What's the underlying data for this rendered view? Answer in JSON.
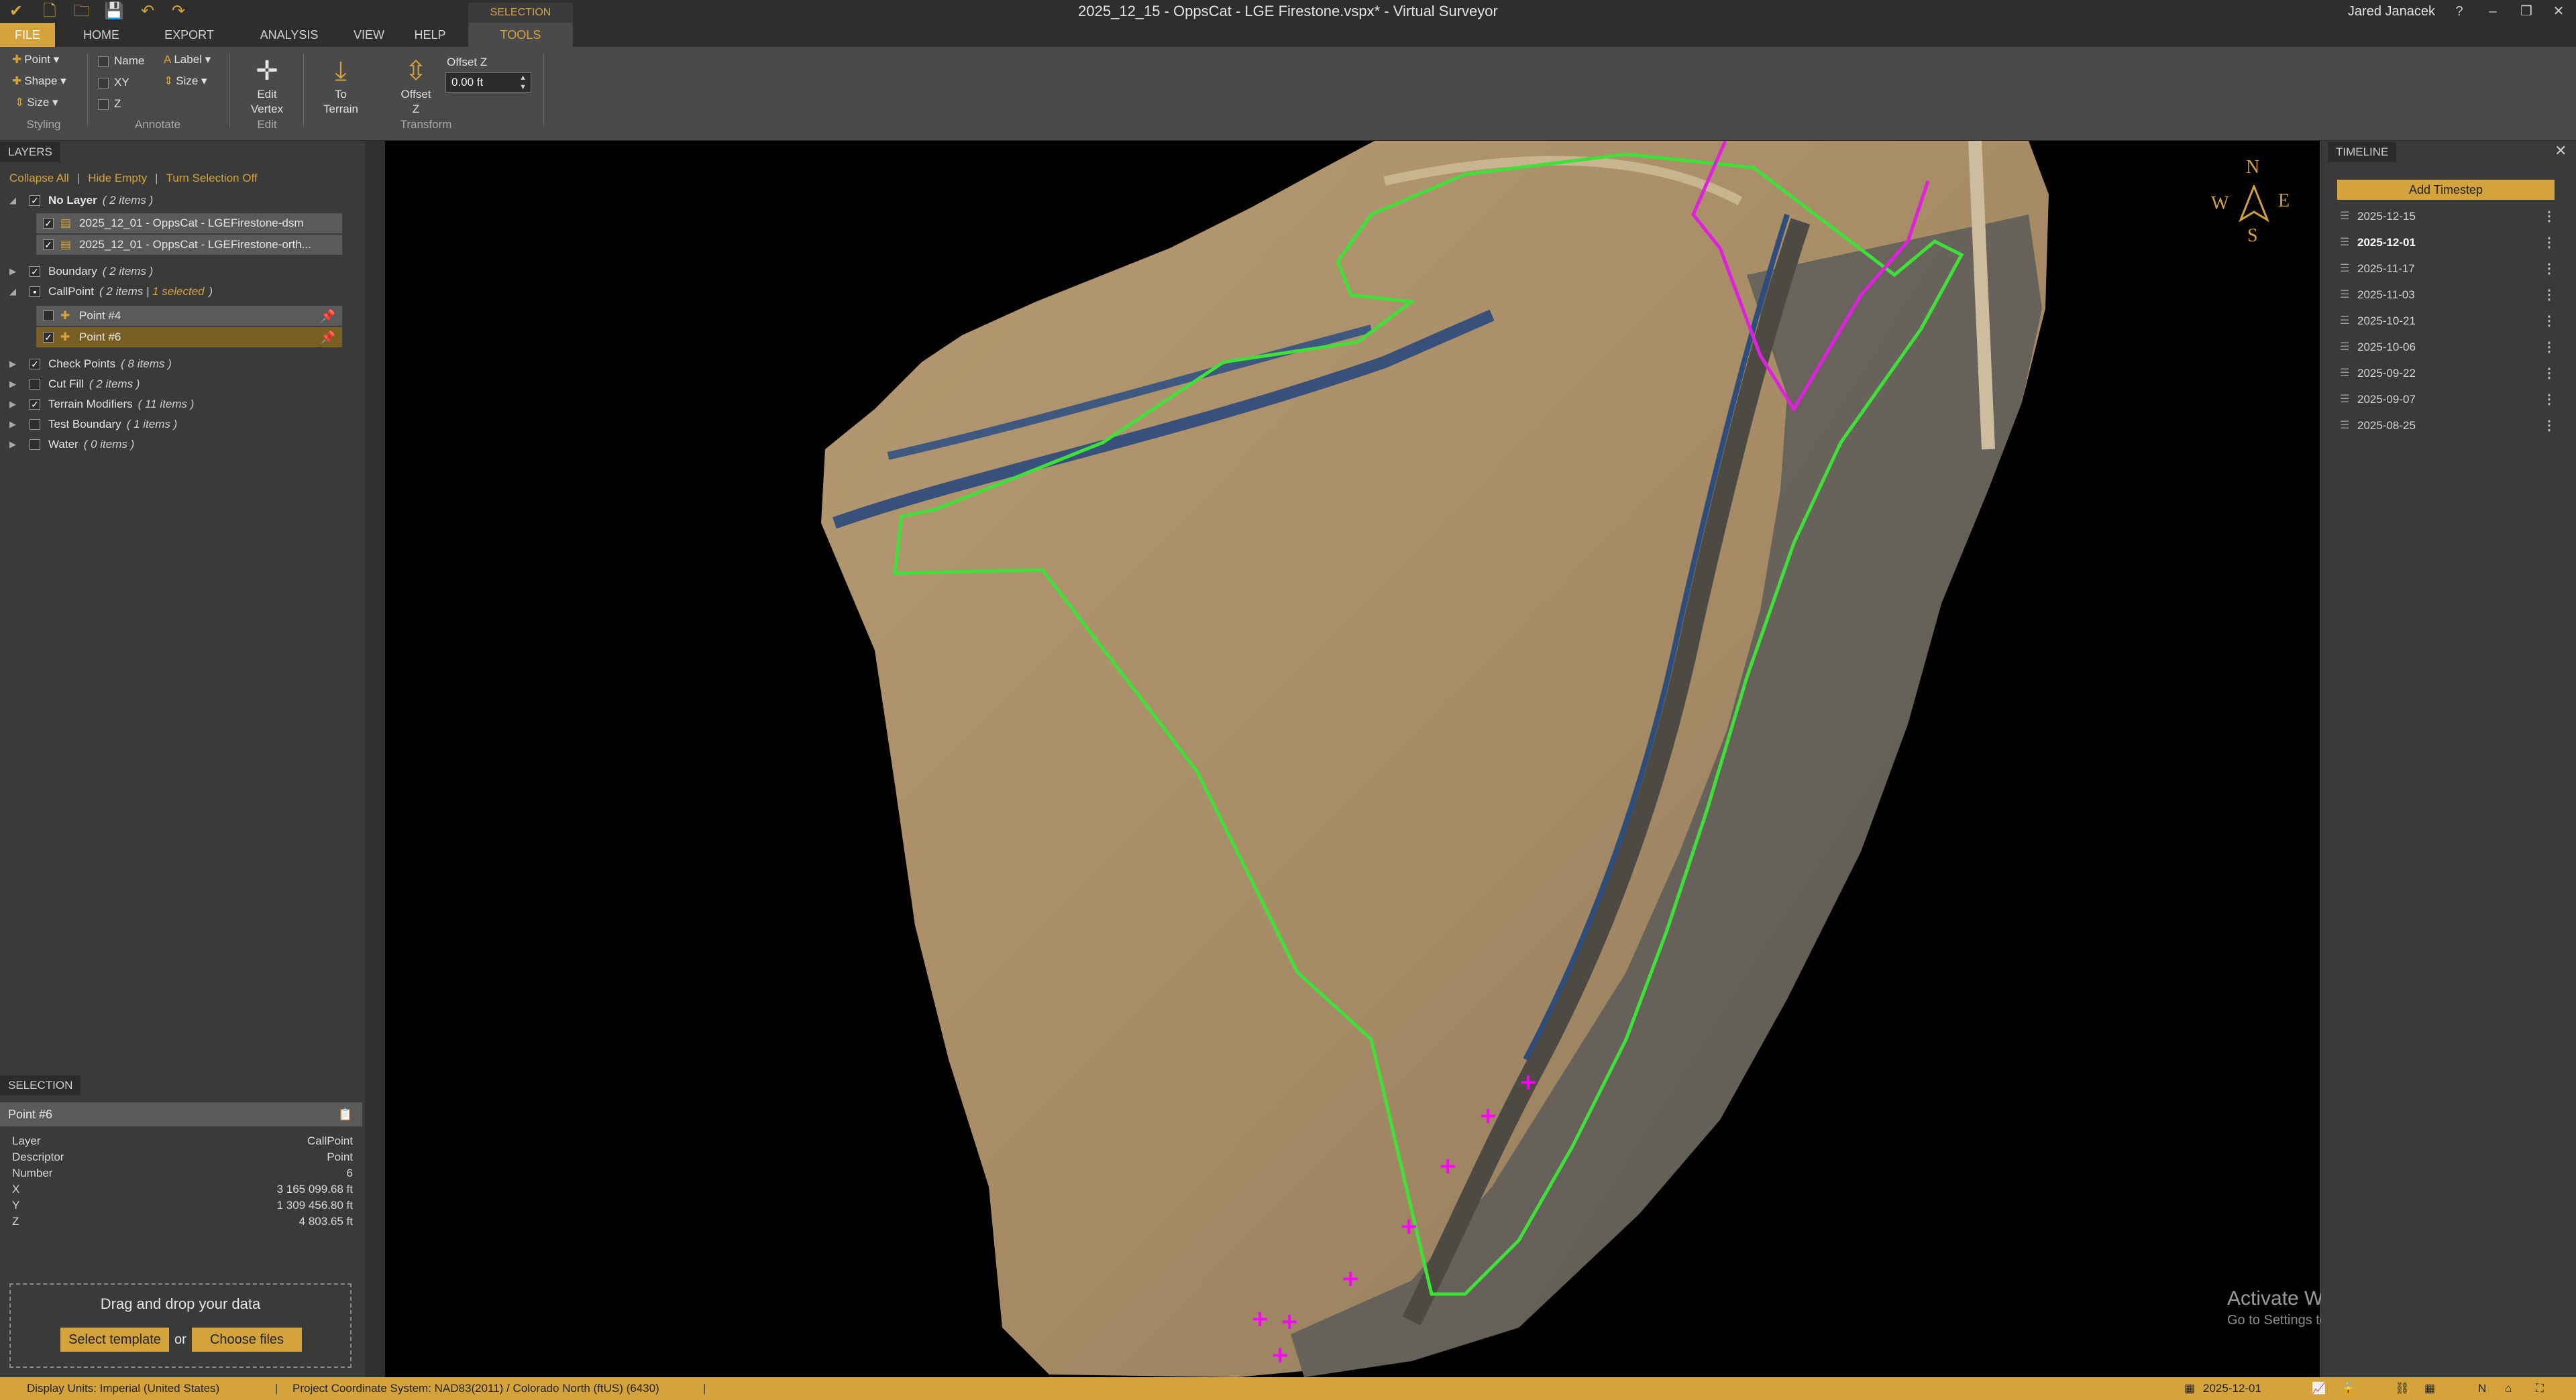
{
  "titlebar": {
    "title": "2025_12_15 - OppsCat - LGE Firestone.vspx*  -  Virtual Surveyor",
    "user": "Jared Janacek"
  },
  "ribbon_tabs": {
    "file": "FILE",
    "home": "HOME",
    "export": "EXPORT",
    "analysis": "ANALYSIS",
    "view": "VIEW",
    "help": "HELP",
    "context": "SELECTION",
    "tools": "TOOLS"
  },
  "ribbon": {
    "styling": {
      "point": "Point",
      "shape": "Shape",
      "size": "Size",
      "label": "Styling"
    },
    "annotate": {
      "name": "Name",
      "xy": "XY",
      "z": "Z",
      "label_btn": "Label",
      "size": "Size",
      "label": "Annotate"
    },
    "edit": {
      "edit_vertex_1": "Edit",
      "edit_vertex_2": "Vertex",
      "label": "Edit"
    },
    "transform": {
      "to_terrain_1": "To",
      "to_terrain_2": "Terrain",
      "offset_z_1": "Offset",
      "offset_z_2": "Z",
      "offset_label": "Offset Z",
      "offset_value": "0.00 ft",
      "label": "Transform"
    }
  },
  "layers": {
    "tab": "LAYERS",
    "actions": {
      "collapse_all": "Collapse All",
      "hide_empty": "Hide Empty",
      "turn_selection_off": "Turn Selection Off"
    },
    "no_layer": {
      "name": "No Layer",
      "count": "( 2 items )"
    },
    "no_layer_items": [
      "2025_12_01 - OppsCat - LGEFirestone-dsm",
      "2025_12_01 - OppsCat - LGEFirestone-orth..."
    ],
    "boundary": {
      "name": "Boundary",
      "count": "( 2 items )"
    },
    "callpoint": {
      "name": "CallPoint",
      "count": "( 2 items |",
      "selected": "1 selected",
      "close": ")"
    },
    "callpoint_items": [
      "Point #4",
      "Point #6"
    ],
    "check_points": {
      "name": "Check Points",
      "count": "( 8 items )"
    },
    "cut_fill": {
      "name": "Cut Fill",
      "count": "( 2 items )"
    },
    "terrain_modifiers": {
      "name": "Terrain Modifiers",
      "count": "( 11 items )"
    },
    "test_boundary": {
      "name": "Test Boundary",
      "count": "( 1 items )"
    },
    "water": {
      "name": "Water",
      "count": "( 0 items )"
    }
  },
  "selection": {
    "tab": "SELECTION",
    "title": "Point #6",
    "props": [
      {
        "k": "Layer",
        "v": "CallPoint"
      },
      {
        "k": "Descriptor",
        "v": "Point"
      },
      {
        "k": "Number",
        "v": "6"
      },
      {
        "k": "X",
        "v": "3 165 099.68 ft"
      },
      {
        "k": "Y",
        "v": "1 309 456.80 ft"
      },
      {
        "k": "Z",
        "v": "4 803.65 ft"
      }
    ]
  },
  "dropzone": {
    "text": "Drag and drop your data",
    "select_template": "Select template",
    "or": "or",
    "choose_files": "Choose files"
  },
  "compass": {
    "n": "N",
    "s": "S",
    "e": "E",
    "w": "W"
  },
  "watermark": {
    "line1": "Activate Windows",
    "line2": "Go to Settings to activate Windows."
  },
  "timeline": {
    "tab": "TIMELINE",
    "add": "Add Timestep",
    "dates": [
      "2025-12-15",
      "2025-12-01",
      "2025-11-17",
      "2025-11-03",
      "2025-10-21",
      "2025-10-06",
      "2025-09-22",
      "2025-09-07",
      "2025-08-25"
    ],
    "active": "2025-12-01"
  },
  "status": {
    "display_units": "Display Units:  Imperial (United States)",
    "coord_system": "Project Coordinate System:  NAD83(2011) / Colorado North (ftUS) (6430)",
    "date": "2025-12-01"
  },
  "colors": {
    "accent": "#d4a33b",
    "boundary_green": "#3fe03a",
    "boundary_magenta": "#e020e0"
  }
}
